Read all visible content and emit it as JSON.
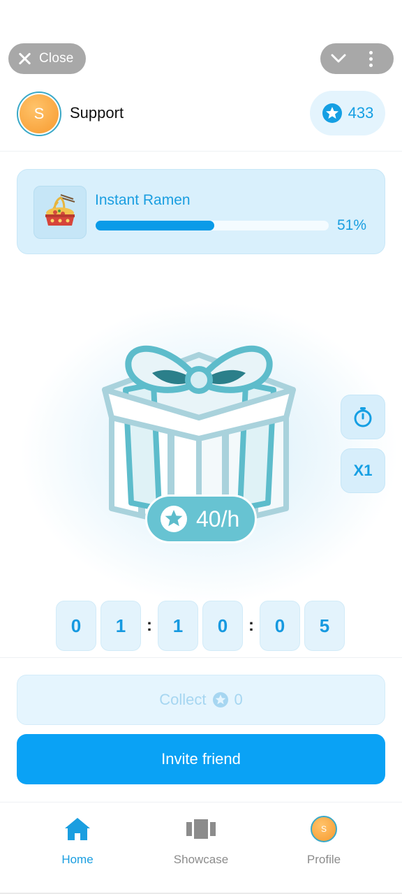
{
  "telegram_bar": {
    "close_label": "Close"
  },
  "header": {
    "avatar_letter": "S",
    "username": "Support",
    "balance": "433"
  },
  "progress": {
    "item_name": "Instant Ramen",
    "percent_label": "51%",
    "fraction": 0.51
  },
  "gift": {
    "rate": "40/h"
  },
  "side_buttons": {
    "multiplier": "X1"
  },
  "timer": {
    "digits": [
      "0",
      "1",
      "1",
      "0",
      "0",
      "5"
    ],
    "separator": ":"
  },
  "actions": {
    "collect_label": "Collect",
    "collect_amount": "0",
    "invite_label": "Invite friend"
  },
  "tabs": [
    {
      "label": "Home",
      "icon": "home-icon",
      "active": true
    },
    {
      "label": "Showcase",
      "icon": "showcase-icon",
      "active": false
    },
    {
      "label": "Profile",
      "icon": "avatar",
      "active": false
    }
  ],
  "profile_avatar_letter": "S",
  "colors": {
    "accent": "#0aa2f5",
    "text_accent": "#1a9ee0",
    "gift_teal": "#67c3d2",
    "avatar_orange": "#f79a2f"
  }
}
